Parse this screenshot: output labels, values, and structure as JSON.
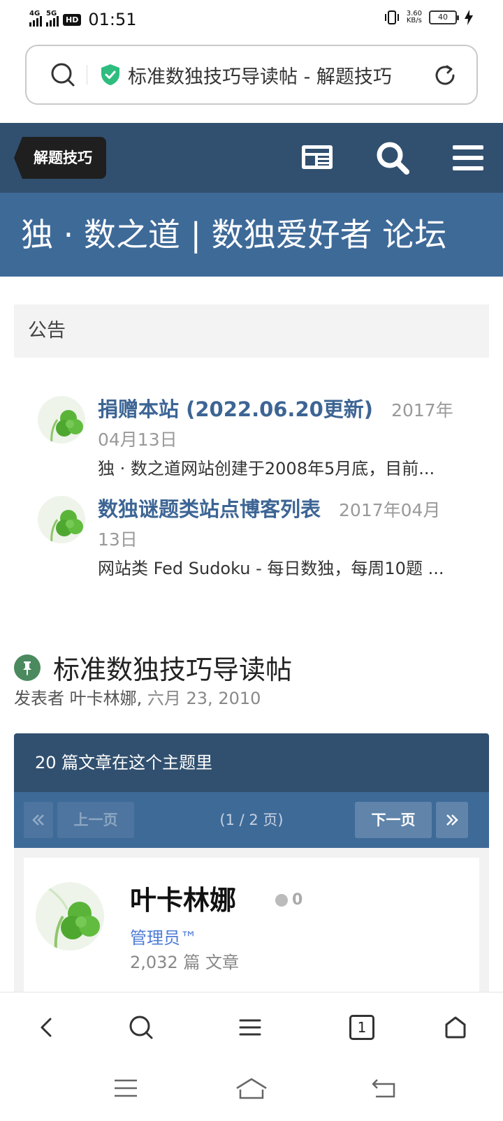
{
  "status_bar": {
    "net1": "4G",
    "net2": "5G",
    "hd": "HD",
    "time": "01:51",
    "speed_value": "3.60",
    "speed_unit": "KB/s",
    "battery": "40"
  },
  "url_bar": {
    "url_text": "标准数独技巧导读帖 - 解题技巧"
  },
  "site_nav": {
    "breadcrumb": "解题技巧",
    "icons": [
      "news-icon",
      "search-icon",
      "menu-icon"
    ]
  },
  "site_title": "独 · 数之道 | 数独爱好者 论坛",
  "announcements": {
    "heading": "公告",
    "items": [
      {
        "title": "捐赠本站 (2022.06.20更新)",
        "date_a": "2017年",
        "date_b": "04月13日",
        "snippet": "独 · 数之道网站创建于2008年5月底，目前..."
      },
      {
        "title": "数独谜题类站点博客列表",
        "date_a": "2017年04月",
        "date_b": "13日",
        "snippet": "网站类 Fed Sudoku - 每日数独，每周10题 ..."
      }
    ]
  },
  "topic": {
    "title": "标准数独技巧导读帖",
    "meta_prefix": "发表者 叶卡林娜, ",
    "meta_date": "六月 23, 2010",
    "post_count": "20 篇文章在这个主题里",
    "pager": {
      "prev": "上一页",
      "info": "(1 / 2 页)",
      "next": "下一页"
    }
  },
  "post": {
    "author": "叶卡林娜",
    "reputation": "0",
    "role": "管理员™",
    "post_count": "2,032 篇 文章"
  },
  "browser_bar": {
    "tab_count": "1",
    "icons": [
      "back-icon",
      "search-icon",
      "menu-icon",
      "tabs-icon",
      "home-icon"
    ]
  },
  "system_nav": {
    "icons": [
      "recent-apps-icon",
      "home-icon",
      "back-icon"
    ]
  }
}
